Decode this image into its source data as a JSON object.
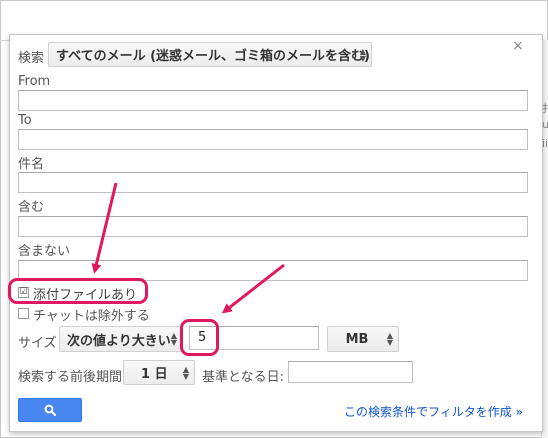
{
  "background": {
    "side_text_1": "扌",
    "side_text_2": "ui",
    "side_text_3": "ii"
  },
  "form": {
    "search_in_label": "検索",
    "search_in_value": "すべてのメール (迷惑メール、ゴミ箱のメールを含む)",
    "from_label": "From",
    "to_label": "To",
    "subject_label": "件名",
    "has_words_label": "含む",
    "doesnt_have_label": "含まない",
    "has_attachment_label": "添付ファイルあり",
    "has_attachment_checked": "☑",
    "exclude_chats_label": "チャットは除外する",
    "size_label": "サイズ",
    "size_operator": "次の値より大きい",
    "size_value": "5",
    "size_unit": "MB",
    "date_within_label": "検索する前後期間",
    "date_within_value": "1 日",
    "of_date_label": "基準となる日:",
    "of_date_value": "",
    "create_filter_link": "この検索条件でフィルタを作成 »",
    "close_symbol": "×",
    "updown_up": "▲",
    "updown_down": "▼"
  },
  "colors": {
    "highlight": "#e0185f",
    "search_button": "#4887f2",
    "link": "#1155cc"
  },
  "icons": {
    "search_button_icon": "search-icon",
    "close_icon": "close-icon"
  }
}
